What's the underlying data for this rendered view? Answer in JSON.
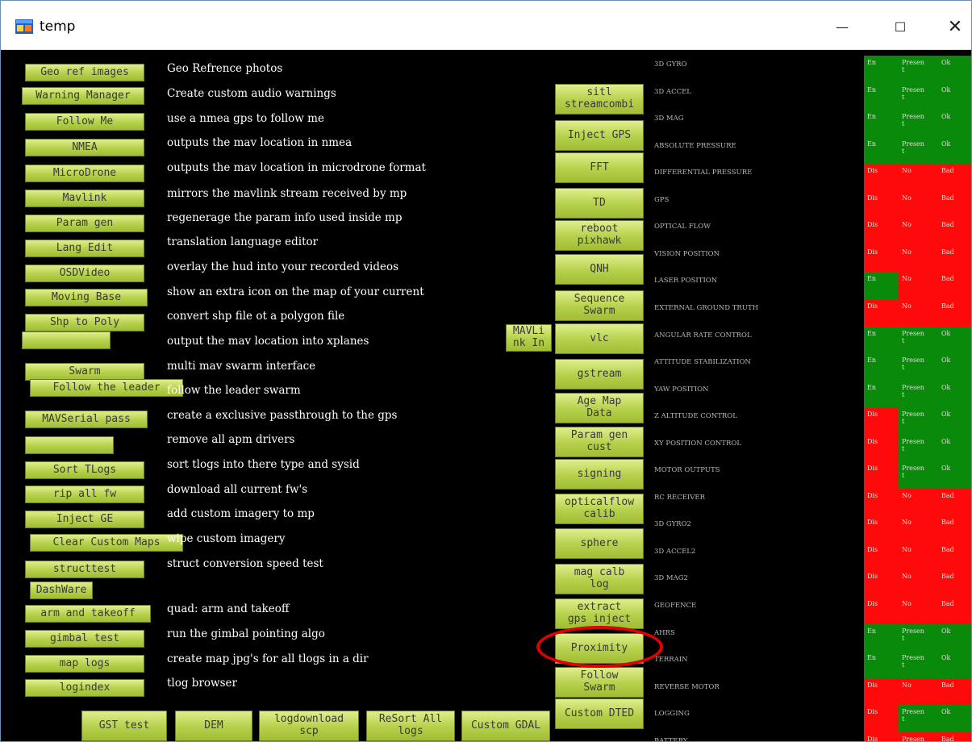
{
  "window": {
    "title": "temp",
    "minimize_glyph": "—",
    "maximize_glyph": "☐",
    "close_glyph": "✕"
  },
  "left_buttons": [
    {
      "label": "Geo ref images",
      "desc": "Geo Refrence photos"
    },
    {
      "label": "Warning Manager",
      "desc": "Create custom audio warnings"
    },
    {
      "label": "Follow Me",
      "desc": "use a nmea gps to follow me"
    },
    {
      "label": "NMEA",
      "desc": "outputs the mav location in nmea"
    },
    {
      "label": "MicroDrone",
      "desc": "outputs the mav location in microdrone format"
    },
    {
      "label": "Mavlink",
      "desc": "mirrors the mavlink stream received by mp"
    },
    {
      "label": "Param gen",
      "desc": "regenerage the param info used inside mp"
    },
    {
      "label": "Lang Edit",
      "desc": "translation language editor"
    },
    {
      "label": "OSDVideo",
      "desc": "overlay the hud into your recorded videos"
    },
    {
      "label": "Moving Base",
      "desc": "show an extra icon on the map of your current"
    },
    {
      "label": "Shp to Poly",
      "desc": "convert shp file ot a polygon file"
    },
    {
      "label": "",
      "desc": "output the mav location into xplanes"
    },
    {
      "label": "Swarm",
      "desc": "multi mav swarm interface"
    },
    {
      "label": "Follow the leader",
      "desc": "follow the leader swarm"
    },
    {
      "label": "MAVSerial pass",
      "desc": "create a exclusive passthrough to the gps"
    },
    {
      "label": "",
      "desc": "remove all apm drivers"
    },
    {
      "label": "Sort TLogs",
      "desc": "sort tlogs into there type and sysid"
    },
    {
      "label": "rip all fw",
      "desc": "download all current fw's"
    },
    {
      "label": "Inject GE",
      "desc": "add custom imagery to mp"
    },
    {
      "label": "Clear Custom Maps",
      "desc": "wipe custom imagery"
    },
    {
      "label": "structtest",
      "desc": "struct conversion speed test"
    },
    {
      "label": "DashWare",
      "desc": ""
    },
    {
      "label": "arm and takeoff",
      "desc": "quad: arm and takeoff"
    },
    {
      "label": "gimbal test",
      "desc": "run the gimbal pointing algo"
    },
    {
      "label": "map logs",
      "desc": "create map jpg's for all tlogs in a dir"
    },
    {
      "label": "logindex",
      "desc": "tlog browser"
    }
  ],
  "mavlink_in_button": "MAVLi\nnk In",
  "middle_buttons": [
    "sitl\nstreamcombi",
    "Inject GPS",
    "FFT",
    "TD",
    "reboot\npixhawk",
    "QNH",
    "Sequence\nSwarm",
    "vlc",
    "gstream",
    "Age Map\nData",
    "Param gen\ncust",
    "signing",
    "opticalflow\ncalib",
    "sphere",
    "mag calb\nlog",
    "extract\ngps inject",
    "Proximity",
    "Follow\nSwarm",
    "Custom DTED"
  ],
  "bottom_buttons": [
    "GST test",
    "DEM",
    "logdownload\nscp",
    "ReSort All\nlogs",
    "Custom GDAL"
  ],
  "sensor_status": {
    "colors": {
      "green": "#0a8a0a",
      "red": "#ff0a0a"
    },
    "rows": [
      {
        "name": "3D GYRO",
        "en": "En",
        "present": "Presen\nt",
        "health": "Ok",
        "c": [
          "g",
          "g",
          "g"
        ]
      },
      {
        "name": "3D ACCEL",
        "en": "En",
        "present": "Presen\nt",
        "health": "Ok",
        "c": [
          "g",
          "g",
          "g"
        ]
      },
      {
        "name": "3D MAG",
        "en": "En",
        "present": "Presen\nt",
        "health": "Ok",
        "c": [
          "g",
          "g",
          "g"
        ]
      },
      {
        "name": "ABSOLUTE PRESSURE",
        "en": "En",
        "present": "Presen\nt",
        "health": "Ok",
        "c": [
          "g",
          "g",
          "g"
        ]
      },
      {
        "name": "DIFFERENTIAL PRESSURE",
        "en": "Dis",
        "present": "No",
        "health": "Bad",
        "c": [
          "r",
          "r",
          "r"
        ]
      },
      {
        "name": "GPS",
        "en": "Dis",
        "present": "No",
        "health": "Bad",
        "c": [
          "r",
          "r",
          "r"
        ]
      },
      {
        "name": "OPTICAL FLOW",
        "en": "Dis",
        "present": "No",
        "health": "Bad",
        "c": [
          "r",
          "r",
          "r"
        ]
      },
      {
        "name": "VISION POSITION",
        "en": "Dis",
        "present": "No",
        "health": "Bad",
        "c": [
          "r",
          "r",
          "r"
        ]
      },
      {
        "name": "LASER POSITION",
        "en": "En",
        "present": "No",
        "health": "Bad",
        "c": [
          "g",
          "r",
          "r"
        ]
      },
      {
        "name": "EXTERNAL GROUND TRUTH",
        "en": "Dis",
        "present": "No",
        "health": "Bad",
        "c": [
          "r",
          "r",
          "r"
        ]
      },
      {
        "name": "ANGULAR RATE CONTROL",
        "en": "En",
        "present": "Presen\nt",
        "health": "Ok",
        "c": [
          "g",
          "g",
          "g"
        ]
      },
      {
        "name": "ATTITUDE STABILIZATION",
        "en": "En",
        "present": "Presen\nt",
        "health": "Ok",
        "c": [
          "g",
          "g",
          "g"
        ]
      },
      {
        "name": "YAW POSITION",
        "en": "En",
        "present": "Presen\nt",
        "health": "Ok",
        "c": [
          "g",
          "g",
          "g"
        ]
      },
      {
        "name": "Z ALTITUDE CONTROL",
        "en": "Dis",
        "present": "Presen\nt",
        "health": "Ok",
        "c": [
          "r",
          "g",
          "g"
        ]
      },
      {
        "name": "XY POSITION CONTROL",
        "en": "Dis",
        "present": "Presen\nt",
        "health": "Ok",
        "c": [
          "r",
          "g",
          "g"
        ]
      },
      {
        "name": "MOTOR OUTPUTS",
        "en": "Dis",
        "present": "Presen\nt",
        "health": "Ok",
        "c": [
          "r",
          "g",
          "g"
        ]
      },
      {
        "name": "RC RECEIVER",
        "en": "Dis",
        "present": "No",
        "health": "Bad",
        "c": [
          "r",
          "r",
          "r"
        ]
      },
      {
        "name": "3D GYRO2",
        "en": "Dis",
        "present": "No",
        "health": "Bad",
        "c": [
          "r",
          "r",
          "r"
        ]
      },
      {
        "name": "3D ACCEL2",
        "en": "Dis",
        "present": "No",
        "health": "Bad",
        "c": [
          "r",
          "r",
          "r"
        ]
      },
      {
        "name": "3D MAG2",
        "en": "Dis",
        "present": "No",
        "health": "Bad",
        "c": [
          "r",
          "r",
          "r"
        ]
      },
      {
        "name": "GEOFENCE",
        "en": "Dis",
        "present": "No",
        "health": "Bad",
        "c": [
          "r",
          "r",
          "r"
        ]
      },
      {
        "name": "AHRS",
        "en": "En",
        "present": "Presen\nt",
        "health": "Ok",
        "c": [
          "g",
          "g",
          "g"
        ]
      },
      {
        "name": "TERRAIN",
        "en": "En",
        "present": "Presen\nt",
        "health": "Ok",
        "c": [
          "g",
          "g",
          "g"
        ]
      },
      {
        "name": "REVERSE MOTOR",
        "en": "Dis",
        "present": "No",
        "health": "Bad",
        "c": [
          "r",
          "r",
          "r"
        ]
      },
      {
        "name": "LOGGING",
        "en": "Dis",
        "present": "Presen\nt",
        "health": "Ok",
        "c": [
          "r",
          "g",
          "g"
        ]
      },
      {
        "name": "BATTERY",
        "en": "Dis",
        "present": "Presen\nt",
        "health": "Bad",
        "c": [
          "r",
          "r",
          "r"
        ]
      }
    ]
  }
}
